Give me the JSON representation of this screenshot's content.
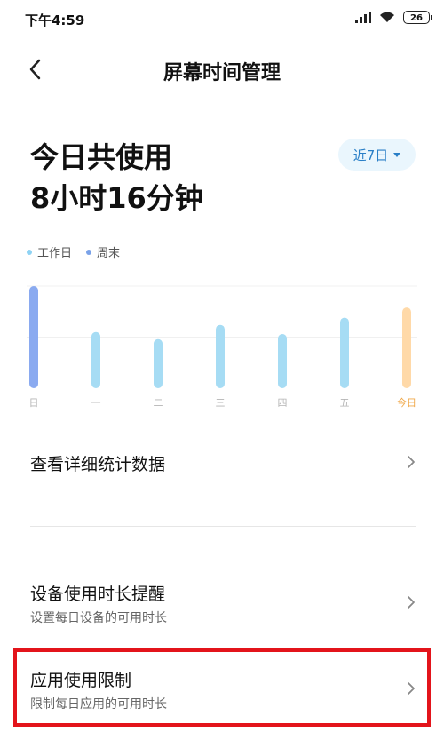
{
  "status_bar": {
    "time": "下午4:59",
    "battery": "26"
  },
  "header": {
    "title": "屏幕时间管理"
  },
  "summary": {
    "label": "今日共使用",
    "value": "8小时16分钟"
  },
  "range_selector": {
    "label": "近7日"
  },
  "legend": [
    {
      "label": "工作日",
      "color": "#8fd3f4"
    },
    {
      "label": "周末",
      "color": "#7aa2e8"
    }
  ],
  "chart_data": {
    "type": "bar",
    "categories": [
      "日",
      "一",
      "二",
      "三",
      "四",
      "五",
      "今日"
    ],
    "values": [
      100,
      55,
      48,
      62,
      53,
      69,
      79
    ],
    "colors": [
      "#8aaaf0",
      "#a6dcf4",
      "#a6dcf4",
      "#a6dcf4",
      "#a6dcf4",
      "#a6dcf4",
      "#ffd9a8"
    ],
    "label_colors": [
      "#b5b5b5",
      "#b5b5b5",
      "#b5b5b5",
      "#b5b5b5",
      "#b5b5b5",
      "#b5b5b5",
      "#f0a84a"
    ],
    "ylim": [
      0,
      100
    ],
    "grid": true
  },
  "menu": {
    "detail": {
      "title": "查看详细统计数据"
    },
    "device_reminder": {
      "title": "设备使用时长提醒",
      "subtitle": "设置每日设备的可用时长"
    },
    "app_limit": {
      "title": "应用使用限制",
      "subtitle": "限制每日应用的可用时长"
    }
  },
  "highlight_color": "#e3141b"
}
